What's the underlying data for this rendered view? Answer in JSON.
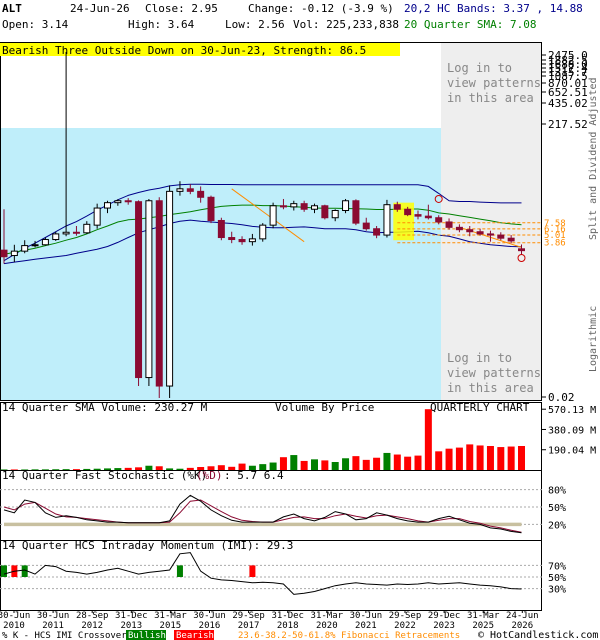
{
  "header": {
    "symbol": "ALT",
    "date": "24-Jun-26",
    "close": "Close: 2.95",
    "change": "Change: -0.12 (-3.9 %)",
    "open": "Open: 3.14",
    "high": "High: 3.64",
    "low": "Low: 2.56",
    "volume": "Vol: 225,233,838",
    "bands": "20,2 HC Bands: 3.37 , 14.88",
    "sma": "20 Quarter SMA: 7.08"
  },
  "colors": {
    "up": "#008000",
    "down": "#8b0a32",
    "band": "#00008b",
    "sma": "#008000",
    "fib": "#ff8c00",
    "cyan": "#bfeefa",
    "highlight": "#ffff00",
    "bullish": "#008000",
    "bearish": "#ff0000",
    "stochK": "#000000",
    "stochD": "#8b0a32",
    "shade": "#c8c0a0"
  },
  "price_panel": {
    "pattern_label": "Bearish Three Outside Down on 30-Jun-23, Strength: 86.5",
    "log_in_top": "Log in to\nview patterns\nin this area",
    "log_in_bottom": "Log in to\nview patterns\nin this area",
    "right_label_1": "Split and Dividend Adjusted",
    "right_label_2": "Logarithmic",
    "y_ticks": [
      "2475.0",
      "1882.5",
      "1688.0",
      "1517.4",
      "1315.7",
      "1087.5",
      "870.01",
      "652.51",
      "435.02",
      "217.52",
      "0.02"
    ],
    "fib_levels": [
      "7.58",
      "6.16",
      "5.01",
      "3.86"
    ]
  },
  "volume_panel": {
    "title": "14 Quarter SMA Volume: 230.27 M",
    "middle_label": "Volume By Price",
    "right_label": "QUARTERLY CHART",
    "y_ticks": [
      "570.13 M",
      "380.09 M",
      "190.04 M"
    ]
  },
  "stoch_panel": {
    "title_prefix": "14 Quarter Fast Stochastic (%K)",
    "title_d": "(%D)",
    "title_values": ": 5.7    6.4",
    "y_ticks": [
      "80%",
      "50%",
      "20%"
    ]
  },
  "imi_panel": {
    "title": "14 Quarter HCS Intraday Momentum (IMI): 29.3",
    "y_ticks": [
      "70%",
      "50%",
      "30%"
    ]
  },
  "x_axis": {
    "labels": [
      [
        "30-Jun",
        "2010"
      ],
      [
        "30-Jun",
        "2011"
      ],
      [
        "28-Sep",
        "2012"
      ],
      [
        "31-Dec",
        "2013"
      ],
      [
        "31-Mar",
        "2015"
      ],
      [
        "30-Jun",
        "2016"
      ],
      [
        "29-Sep",
        "2017"
      ],
      [
        "31-Dec",
        "2018"
      ],
      [
        "31-Mar",
        "2020"
      ],
      [
        "30-Jun",
        "2021"
      ],
      [
        "29-Sep",
        "2022"
      ],
      [
        "29-Dec",
        "2023"
      ],
      [
        "31-Mar",
        "2025"
      ],
      [
        "24-Jun",
        "2026"
      ]
    ]
  },
  "footer": {
    "prefix": "% K - HCS IMI Crossover:",
    "bullish": "Bullish",
    "bearish": "Bearish",
    "fib": "23.6-38.2-50-61.8% Fibonacci Retracements",
    "credit": "© HotCandlestick.com"
  },
  "chart_data": {
    "type": "candlestick",
    "x_period": "quarter",
    "y_scale": "log",
    "ylim": [
      0.02,
      2475.0
    ],
    "candles": [
      {
        "o": 3.0,
        "h": 12.0,
        "l": 1.9,
        "c": 2.4
      },
      {
        "o": 2.5,
        "h": 3.6,
        "l": 2.0,
        "c": 2.9
      },
      {
        "o": 2.9,
        "h": 4.2,
        "l": 2.7,
        "c": 3.5
      },
      {
        "o": 3.5,
        "h": 4.1,
        "l": 3.3,
        "c": 3.6
      },
      {
        "o": 3.6,
        "h": 4.6,
        "l": 3.5,
        "c": 4.3
      },
      {
        "o": 4.3,
        "h": 5.6,
        "l": 4.1,
        "c": 5.2
      },
      {
        "o": 5.2,
        "h": 2475.0,
        "l": 4.8,
        "c": 5.5
      },
      {
        "o": 5.5,
        "h": 6.8,
        "l": 4.9,
        "c": 5.4
      },
      {
        "o": 5.4,
        "h": 8.0,
        "l": 5.2,
        "c": 7.2
      },
      {
        "o": 7.0,
        "h": 14.5,
        "l": 6.2,
        "c": 12.5
      },
      {
        "o": 12.5,
        "h": 16.0,
        "l": 10.5,
        "c": 15.0
      },
      {
        "o": 15.0,
        "h": 16.8,
        "l": 13.5,
        "c": 16.0
      },
      {
        "o": 16.0,
        "h": 17.5,
        "l": 14.0,
        "c": 15.5
      },
      {
        "o": 15.5,
        "h": 16.2,
        "l": 0.03,
        "c": 0.04
      },
      {
        "o": 0.04,
        "h": 17.0,
        "l": 0.03,
        "c": 16.0
      },
      {
        "o": 16.0,
        "h": 18.0,
        "l": 0.02,
        "c": 0.03
      },
      {
        "o": 0.03,
        "h": 27.0,
        "l": 0.02,
        "c": 22.0
      },
      {
        "o": 22.0,
        "h": 31.0,
        "l": 19.0,
        "c": 24.0
      },
      {
        "o": 24.0,
        "h": 28.0,
        "l": 20.0,
        "c": 22.0
      },
      {
        "o": 22.0,
        "h": 26.0,
        "l": 15.0,
        "c": 18.0
      },
      {
        "o": 18.0,
        "h": 19.0,
        "l": 7.5,
        "c": 8.2
      },
      {
        "o": 8.2,
        "h": 9.0,
        "l": 4.2,
        "c": 4.6
      },
      {
        "o": 4.6,
        "h": 5.6,
        "l": 3.8,
        "c": 4.3
      },
      {
        "o": 4.3,
        "h": 4.8,
        "l": 3.6,
        "c": 4.0
      },
      {
        "o": 4.0,
        "h": 5.2,
        "l": 3.5,
        "c": 4.4
      },
      {
        "o": 4.4,
        "h": 7.5,
        "l": 4.0,
        "c": 7.0
      },
      {
        "o": 7.0,
        "h": 15.0,
        "l": 6.3,
        "c": 13.5
      },
      {
        "o": 13.5,
        "h": 17.0,
        "l": 12.0,
        "c": 13.0
      },
      {
        "o": 13.0,
        "h": 16.0,
        "l": 11.5,
        "c": 14.5
      },
      {
        "o": 14.5,
        "h": 16.0,
        "l": 11.0,
        "c": 12.0
      },
      {
        "o": 12.0,
        "h": 14.5,
        "l": 10.5,
        "c": 13.5
      },
      {
        "o": 13.5,
        "h": 14.0,
        "l": 8.5,
        "c": 9.0
      },
      {
        "o": 9.0,
        "h": 12.0,
        "l": 8.0,
        "c": 11.5
      },
      {
        "o": 11.5,
        "h": 17.0,
        "l": 10.5,
        "c": 16.0
      },
      {
        "o": 16.0,
        "h": 16.8,
        "l": 7.0,
        "c": 7.5
      },
      {
        "o": 7.5,
        "h": 9.0,
        "l": 5.8,
        "c": 6.2
      },
      {
        "o": 6.2,
        "h": 6.8,
        "l": 4.5,
        "c": 5.0
      },
      {
        "o": 5.0,
        "h": 16.5,
        "l": 4.6,
        "c": 14.0
      },
      {
        "o": 14.0,
        "h": 15.5,
        "l": 11.0,
        "c": 12.0
      },
      {
        "o": 12.0,
        "h": 13.0,
        "l": 9.5,
        "c": 10.0
      },
      {
        "o": 10.0,
        "h": 11.5,
        "l": 8.5,
        "c": 9.5
      },
      {
        "o": 9.5,
        "h": 14.0,
        "l": 8.5,
        "c": 9.0
      },
      {
        "o": 9.0,
        "h": 9.8,
        "l": 7.2,
        "c": 7.8
      },
      {
        "o": 7.8,
        "h": 8.8,
        "l": 6.0,
        "c": 6.5
      },
      {
        "o": 6.5,
        "h": 7.2,
        "l": 5.5,
        "c": 6.0
      },
      {
        "o": 6.0,
        "h": 6.8,
        "l": 4.8,
        "c": 5.6
      },
      {
        "o": 5.6,
        "h": 6.2,
        "l": 4.9,
        "c": 5.2
      },
      {
        "o": 5.2,
        "h": 5.8,
        "l": 4.0,
        "c": 5.0
      },
      {
        "o": 5.0,
        "h": 5.5,
        "l": 4.2,
        "c": 4.5
      },
      {
        "o": 4.5,
        "h": 5.0,
        "l": 3.8,
        "c": 4.1
      },
      {
        "o": 3.14,
        "h": 3.64,
        "l": 2.56,
        "c": 2.95
      }
    ],
    "upper_band": [
      2.1,
      2.6,
      3.2,
      3.8,
      4.6,
      5.6,
      6.8,
      7.9,
      9.5,
      11.6,
      13.8,
      16.5,
      19.2,
      21.2,
      23.0,
      24.5,
      26.5,
      27.5,
      28.0,
      28.0,
      27.8,
      27.8,
      27.8,
      27.6,
      27.6,
      27.6,
      27.6,
      27.6,
      27.6,
      27.6,
      27.6,
      27.6,
      27.6,
      27.6,
      27.6,
      27.6,
      27.6,
      27.6,
      27.6,
      27.6,
      27.6,
      26.0,
      20.5,
      16.0,
      15.6,
      15.6,
      15.3,
      15.1,
      14.9,
      14.9,
      14.88
    ],
    "sma": [
      2.6,
      2.8,
      3.0,
      3.2,
      3.5,
      3.8,
      4.2,
      4.6,
      5.2,
      6.0,
      6.8,
      7.8,
      8.4,
      8.6,
      9.0,
      9.4,
      10.0,
      10.5,
      11.0,
      11.8,
      12.5,
      13.2,
      13.6,
      13.8,
      13.8,
      13.6,
      13.6,
      13.4,
      13.1,
      12.8,
      12.5,
      12.4,
      12.4,
      12.3,
      12.2,
      12.1,
      11.9,
      11.9,
      12.0,
      12.1,
      12.1,
      11.6,
      10.6,
      10.2,
      9.6,
      9.1,
      8.6,
      8.1,
      7.6,
      7.3,
      7.08
    ],
    "lower_band": [
      1.9,
      2.0,
      2.1,
      2.2,
      2.3,
      2.4,
      2.5,
      2.7,
      2.9,
      3.1,
      3.4,
      3.9,
      4.6,
      5.4,
      6.0,
      6.6,
      7.4,
      8.0,
      8.3,
      8.0,
      7.8,
      7.6,
      7.4,
      7.1,
      6.7,
      6.5,
      6.4,
      6.4,
      6.5,
      6.6,
      6.4,
      6.2,
      6.2,
      6.2,
      6.0,
      5.6,
      5.4,
      5.5,
      5.5,
      5.6,
      5.7,
      5.4,
      5.0,
      4.8,
      4.4,
      4.0,
      3.8,
      3.6,
      3.5,
      3.4,
      3.37
    ],
    "fib_retracements": [
      7.58,
      6.16,
      5.01,
      3.86
    ],
    "volume": [
      5,
      5,
      5,
      6,
      6,
      7,
      8,
      8,
      10,
      12,
      15,
      18,
      20,
      25,
      40,
      35,
      15,
      12,
      20,
      28,
      35,
      45,
      30,
      60,
      40,
      55,
      70,
      120,
      140,
      85,
      100,
      90,
      75,
      110,
      130,
      95,
      115,
      160,
      145,
      125,
      135,
      150,
      175,
      200,
      210,
      240,
      230,
      225,
      215,
      220,
      225
    ],
    "volume_up": [
      true,
      false,
      true,
      true,
      true,
      true,
      true,
      false,
      true,
      true,
      true,
      true,
      false,
      false,
      true,
      false,
      true,
      true,
      false,
      false,
      false,
      false,
      false,
      false,
      true,
      true,
      true,
      false,
      true,
      false,
      true,
      false,
      true,
      true,
      false,
      false,
      false,
      true,
      false,
      false,
      false,
      false,
      false,
      false,
      false,
      false,
      false,
      false,
      false,
      false,
      false
    ],
    "volume_spike_index": 41,
    "volume_spike_value": 570,
    "volume_ylim": [
      0,
      600
    ],
    "stoch_k": [
      45,
      40,
      62,
      58,
      40,
      32,
      35,
      32,
      28,
      26,
      24,
      24,
      23,
      23,
      23,
      23,
      26,
      55,
      70,
      60,
      45,
      35,
      27,
      24,
      24,
      24,
      24,
      33,
      38,
      30,
      26,
      32,
      42,
      38,
      28,
      30,
      40,
      36,
      30,
      26,
      24,
      24,
      30,
      34,
      28,
      22,
      20,
      14,
      12,
      8,
      5.7
    ],
    "stoch_d": [
      50,
      45,
      55,
      58,
      48,
      38,
      33,
      32,
      30,
      28,
      26,
      24,
      23,
      23,
      23,
      23,
      24,
      40,
      60,
      62,
      52,
      42,
      33,
      27,
      25,
      24,
      24,
      28,
      32,
      33,
      30,
      30,
      35,
      38,
      34,
      31,
      35,
      36,
      33,
      30,
      26,
      24,
      27,
      30,
      30,
      25,
      22,
      17,
      14,
      10,
      6.4
    ],
    "stoch_ylim": [
      0,
      100
    ],
    "imi": [
      55,
      60,
      62,
      55,
      70,
      68,
      60,
      58,
      55,
      58,
      62,
      65,
      60,
      55,
      58,
      60,
      62,
      90,
      92,
      60,
      48,
      45,
      44,
      42,
      40,
      41,
      40,
      38,
      20,
      22,
      25,
      30,
      35,
      38,
      40,
      38,
      37,
      36,
      38,
      37,
      38,
      40,
      38,
      39,
      40,
      38,
      36,
      35,
      33,
      30,
      29.3
    ],
    "imi_ylim": [
      0,
      100
    ],
    "crossovers": [
      {
        "index": 0,
        "type": "bullish"
      },
      {
        "index": 1,
        "type": "bearish"
      },
      {
        "index": 2,
        "type": "bullish"
      },
      {
        "index": 17,
        "type": "bullish"
      },
      {
        "index": 24,
        "type": "bearish"
      }
    ]
  }
}
